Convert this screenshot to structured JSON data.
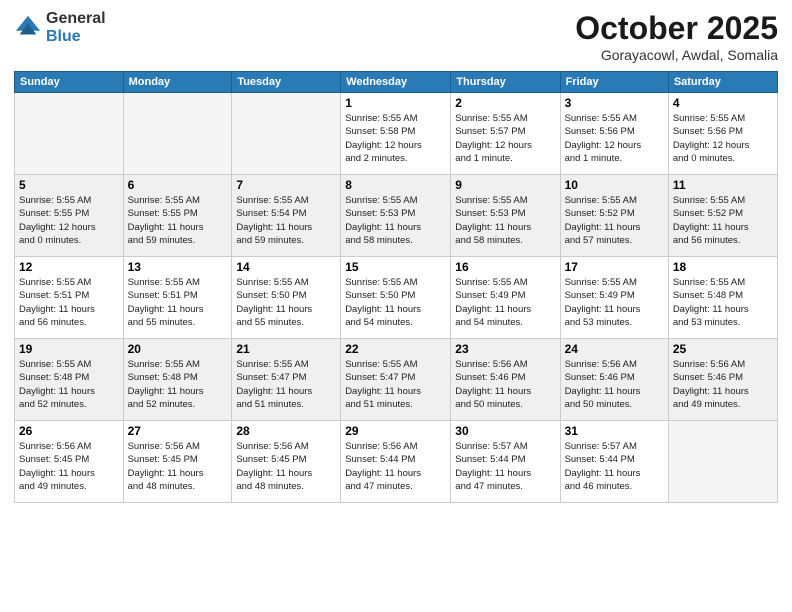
{
  "logo": {
    "line1": "General",
    "line2": "Blue"
  },
  "header": {
    "month": "October 2025",
    "location": "Gorayacowl, Awdal, Somalia"
  },
  "weekdays": [
    "Sunday",
    "Monday",
    "Tuesday",
    "Wednesday",
    "Thursday",
    "Friday",
    "Saturday"
  ],
  "weeks": [
    [
      {
        "day": "",
        "info": ""
      },
      {
        "day": "",
        "info": ""
      },
      {
        "day": "",
        "info": ""
      },
      {
        "day": "1",
        "info": "Sunrise: 5:55 AM\nSunset: 5:58 PM\nDaylight: 12 hours\nand 2 minutes."
      },
      {
        "day": "2",
        "info": "Sunrise: 5:55 AM\nSunset: 5:57 PM\nDaylight: 12 hours\nand 1 minute."
      },
      {
        "day": "3",
        "info": "Sunrise: 5:55 AM\nSunset: 5:56 PM\nDaylight: 12 hours\nand 1 minute."
      },
      {
        "day": "4",
        "info": "Sunrise: 5:55 AM\nSunset: 5:56 PM\nDaylight: 12 hours\nand 0 minutes."
      }
    ],
    [
      {
        "day": "5",
        "info": "Sunrise: 5:55 AM\nSunset: 5:55 PM\nDaylight: 12 hours\nand 0 minutes."
      },
      {
        "day": "6",
        "info": "Sunrise: 5:55 AM\nSunset: 5:55 PM\nDaylight: 11 hours\nand 59 minutes."
      },
      {
        "day": "7",
        "info": "Sunrise: 5:55 AM\nSunset: 5:54 PM\nDaylight: 11 hours\nand 59 minutes."
      },
      {
        "day": "8",
        "info": "Sunrise: 5:55 AM\nSunset: 5:53 PM\nDaylight: 11 hours\nand 58 minutes."
      },
      {
        "day": "9",
        "info": "Sunrise: 5:55 AM\nSunset: 5:53 PM\nDaylight: 11 hours\nand 58 minutes."
      },
      {
        "day": "10",
        "info": "Sunrise: 5:55 AM\nSunset: 5:52 PM\nDaylight: 11 hours\nand 57 minutes."
      },
      {
        "day": "11",
        "info": "Sunrise: 5:55 AM\nSunset: 5:52 PM\nDaylight: 11 hours\nand 56 minutes."
      }
    ],
    [
      {
        "day": "12",
        "info": "Sunrise: 5:55 AM\nSunset: 5:51 PM\nDaylight: 11 hours\nand 56 minutes."
      },
      {
        "day": "13",
        "info": "Sunrise: 5:55 AM\nSunset: 5:51 PM\nDaylight: 11 hours\nand 55 minutes."
      },
      {
        "day": "14",
        "info": "Sunrise: 5:55 AM\nSunset: 5:50 PM\nDaylight: 11 hours\nand 55 minutes."
      },
      {
        "day": "15",
        "info": "Sunrise: 5:55 AM\nSunset: 5:50 PM\nDaylight: 11 hours\nand 54 minutes."
      },
      {
        "day": "16",
        "info": "Sunrise: 5:55 AM\nSunset: 5:49 PM\nDaylight: 11 hours\nand 54 minutes."
      },
      {
        "day": "17",
        "info": "Sunrise: 5:55 AM\nSunset: 5:49 PM\nDaylight: 11 hours\nand 53 minutes."
      },
      {
        "day": "18",
        "info": "Sunrise: 5:55 AM\nSunset: 5:48 PM\nDaylight: 11 hours\nand 53 minutes."
      }
    ],
    [
      {
        "day": "19",
        "info": "Sunrise: 5:55 AM\nSunset: 5:48 PM\nDaylight: 11 hours\nand 52 minutes."
      },
      {
        "day": "20",
        "info": "Sunrise: 5:55 AM\nSunset: 5:48 PM\nDaylight: 11 hours\nand 52 minutes."
      },
      {
        "day": "21",
        "info": "Sunrise: 5:55 AM\nSunset: 5:47 PM\nDaylight: 11 hours\nand 51 minutes."
      },
      {
        "day": "22",
        "info": "Sunrise: 5:55 AM\nSunset: 5:47 PM\nDaylight: 11 hours\nand 51 minutes."
      },
      {
        "day": "23",
        "info": "Sunrise: 5:56 AM\nSunset: 5:46 PM\nDaylight: 11 hours\nand 50 minutes."
      },
      {
        "day": "24",
        "info": "Sunrise: 5:56 AM\nSunset: 5:46 PM\nDaylight: 11 hours\nand 50 minutes."
      },
      {
        "day": "25",
        "info": "Sunrise: 5:56 AM\nSunset: 5:46 PM\nDaylight: 11 hours\nand 49 minutes."
      }
    ],
    [
      {
        "day": "26",
        "info": "Sunrise: 5:56 AM\nSunset: 5:45 PM\nDaylight: 11 hours\nand 49 minutes."
      },
      {
        "day": "27",
        "info": "Sunrise: 5:56 AM\nSunset: 5:45 PM\nDaylight: 11 hours\nand 48 minutes."
      },
      {
        "day": "28",
        "info": "Sunrise: 5:56 AM\nSunset: 5:45 PM\nDaylight: 11 hours\nand 48 minutes."
      },
      {
        "day": "29",
        "info": "Sunrise: 5:56 AM\nSunset: 5:44 PM\nDaylight: 11 hours\nand 47 minutes."
      },
      {
        "day": "30",
        "info": "Sunrise: 5:57 AM\nSunset: 5:44 PM\nDaylight: 11 hours\nand 47 minutes."
      },
      {
        "day": "31",
        "info": "Sunrise: 5:57 AM\nSunset: 5:44 PM\nDaylight: 11 hours\nand 46 minutes."
      },
      {
        "day": "",
        "info": ""
      }
    ]
  ]
}
